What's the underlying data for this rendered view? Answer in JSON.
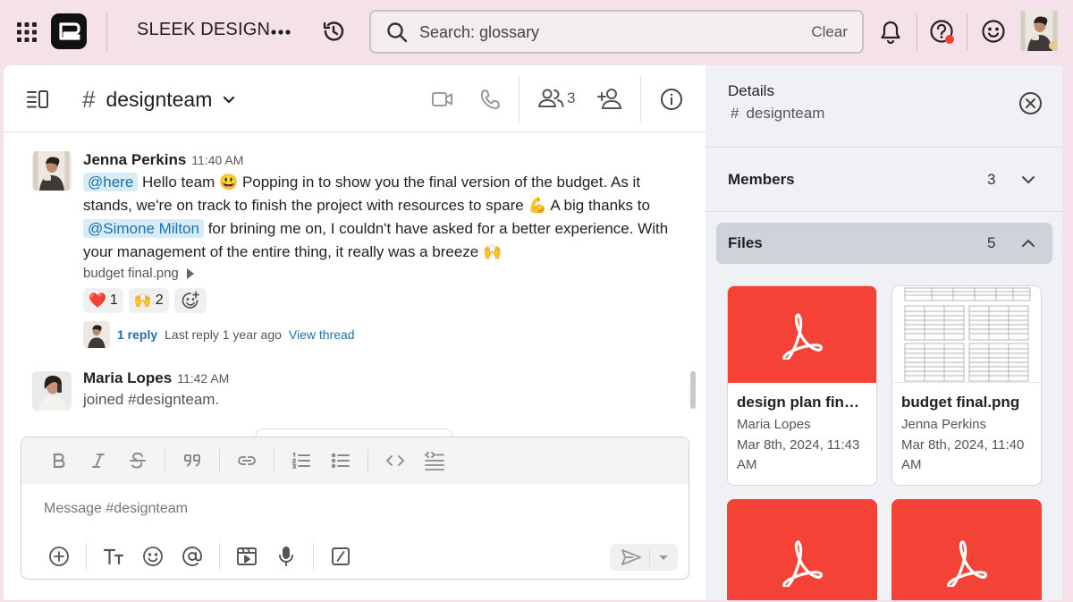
{
  "topbar": {
    "workspace_name": "SLEEK DESIGN",
    "search_value": "Search: glossary",
    "search_clear": "Clear"
  },
  "channel": {
    "hash": "#",
    "name": "designteam",
    "member_count": "3"
  },
  "messages": [
    {
      "author": "Jenna Perkins",
      "time": "11:40 AM",
      "mention_here": "@here",
      "text_1": "Hello team",
      "emoji_1": "😃",
      "text_2": "Popping in to show you the final version of the budget. As it stands, we're on track to finish the project with resources to spare",
      "emoji_2": "💪",
      "text_3": "A big thanks to",
      "mention_user": "@Simone Milton",
      "text_4": "for brining me on, I couldn't have asked for a better experience. With your management of the entire thing, it really was a breeze",
      "emoji_3": "🙌",
      "attachment": "budget final.png",
      "reactions": [
        {
          "emoji": "❤️",
          "count": "1"
        },
        {
          "emoji": "🙌",
          "count": "2"
        }
      ],
      "thread": {
        "replies": "1 reply",
        "last_reply": "Last reply 1 year ago",
        "view": "View thread"
      }
    },
    {
      "author": "Maria Lopes",
      "time": "11:42 AM",
      "text": "joined #designteam."
    }
  ],
  "composer": {
    "placeholder": "Message #designteam"
  },
  "details": {
    "title": "Details",
    "channel_hash": "#",
    "channel_name": "designteam",
    "members_label": "Members",
    "members_count": "3",
    "files_label": "Files",
    "files_count": "5",
    "files": [
      {
        "name": "design plan final...",
        "owner": "Maria Lopes",
        "date": "Mar 8th, 2024, 11:43 AM",
        "type": "pdf"
      },
      {
        "name": "budget final.png",
        "owner": "Jenna Perkins",
        "date": "Mar 8th, 2024, 11:40 AM",
        "type": "sheet"
      },
      {
        "type": "pdf"
      },
      {
        "type": "pdf"
      }
    ]
  },
  "colors": {
    "background": "#f5e1ea",
    "mention_bg": "#d7ecf7",
    "mention_text": "#1e72a8",
    "pdf_red": "#f44336",
    "notification_dot": "#f44336"
  }
}
